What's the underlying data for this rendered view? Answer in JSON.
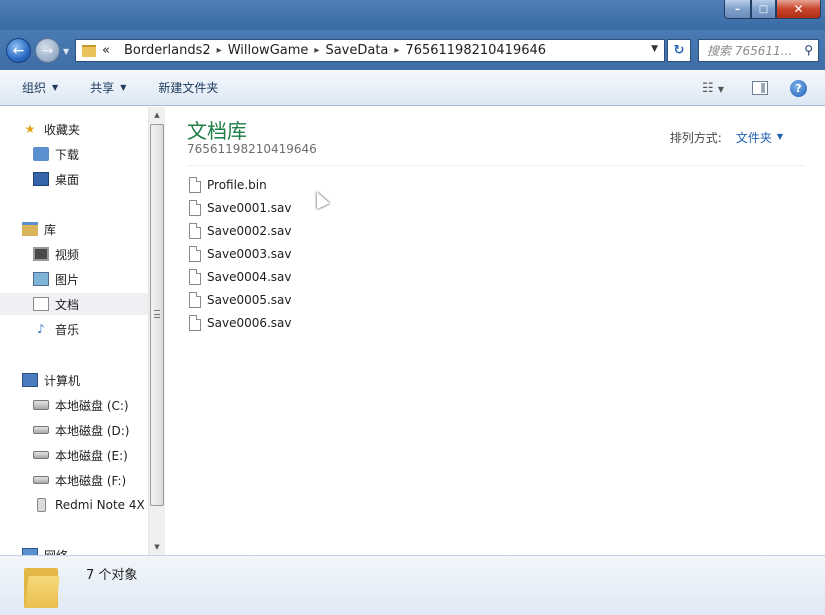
{
  "window": {
    "min_label": "–",
    "max_label": "□",
    "close_label": "✕"
  },
  "address": {
    "prefix": "«",
    "crumbs": [
      "Borderlands2",
      "WillowGame",
      "SaveData",
      "76561198210419646"
    ],
    "separator": "▸",
    "search_placeholder": "搜索 765611..."
  },
  "toolbar": {
    "organize": "组织",
    "share": "共享",
    "new_folder": "新建文件夹",
    "help": "?"
  },
  "nav": {
    "favorites": "收藏夹",
    "downloads": "下载",
    "desktop": "桌面",
    "libraries": "库",
    "videos": "视频",
    "pictures": "图片",
    "documents": "文档",
    "music": "音乐",
    "computer": "计算机",
    "drive_c": "本地磁盘 (C:)",
    "drive_d": "本地磁盘 (D:)",
    "drive_e": "本地磁盘 (E:)",
    "drive_f": "本地磁盘 (F:)",
    "phone": "Redmi Note 4X",
    "network": "网络"
  },
  "content": {
    "library_title": "文档库",
    "path": "76561198210419646",
    "arrange_label": "排列方式:",
    "arrange_value": "文件夹",
    "files": [
      "Profile.bin",
      "Save0001.sav",
      "Save0002.sav",
      "Save0003.sav",
      "Save0004.sav",
      "Save0005.sav",
      "Save0006.sav"
    ]
  },
  "status": {
    "count": "7 个对象"
  }
}
